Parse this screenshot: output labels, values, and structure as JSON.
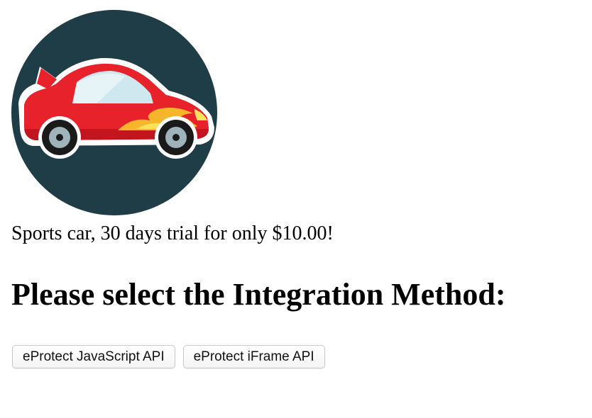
{
  "product": {
    "image_icon": "sports-car-icon",
    "description": "Sports car, 30 days trial for only $10.00!"
  },
  "heading": "Please select the Integration Method:",
  "buttons": {
    "javascript_api": "eProtect JavaScript API",
    "iframe_api": "eProtect iFrame API"
  },
  "colors": {
    "circle_background": "#1f3d46",
    "car_body": "#e8222b",
    "car_window": "#cfe8ef",
    "flame": "#f6b52a"
  }
}
